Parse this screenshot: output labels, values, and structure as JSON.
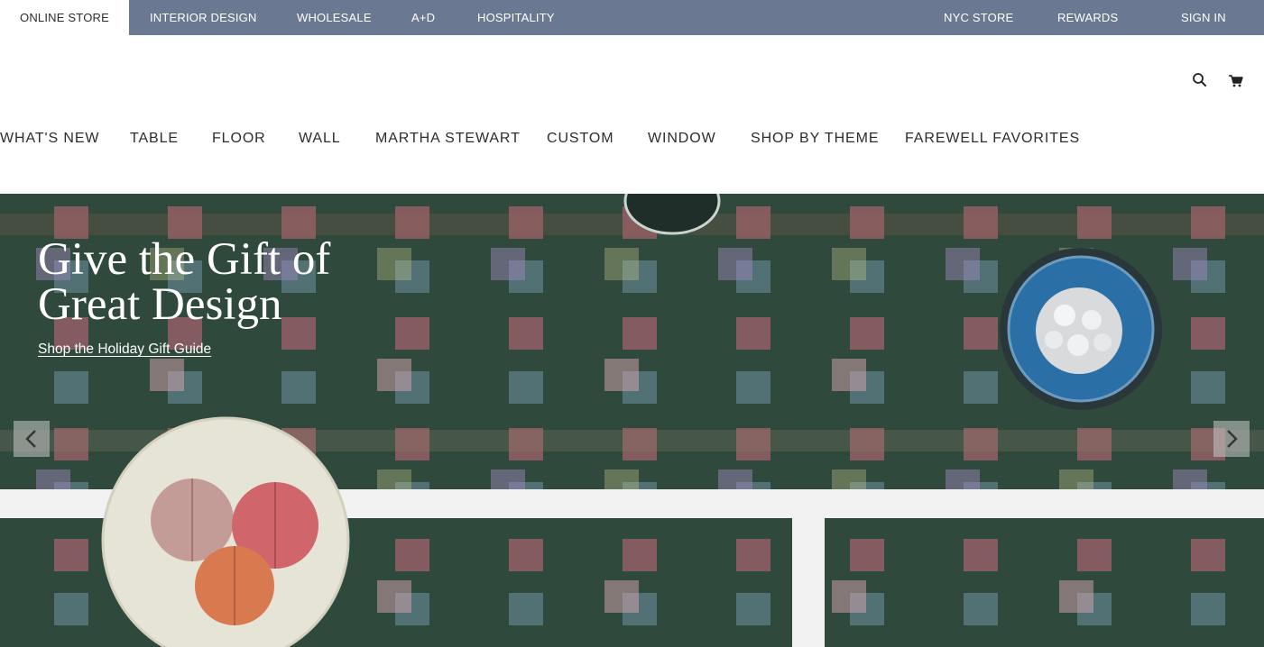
{
  "topbar": {
    "tabs": [
      "ONLINE STORE",
      "INTERIOR DESIGN",
      "WHOLESALE",
      "A+D",
      "HOSPITALITY"
    ],
    "right_links": [
      "NYC STORE",
      "REWARDS",
      "SIGN IN"
    ],
    "active_tab": "ONLINE STORE",
    "bar_color": "#6b7892"
  },
  "header": {
    "icons": [
      "search-icon",
      "cart-icon"
    ]
  },
  "nav": {
    "items": [
      "WHAT'S NEW",
      "TABLE",
      "FLOOR",
      "WALL",
      "MARTHA STEWART",
      "CUSTOM",
      "WINDOW",
      "SHOP BY THEME",
      "FAREWELL FAVORITES"
    ]
  },
  "hero": {
    "title_line1": "Give the Gift of",
    "title_line2": "Great Design",
    "link": "Shop the Holiday Gift Guide",
    "prev_icon": "chevron-left-icon",
    "next_icon": "chevron-right-icon",
    "background_color": "#2f4a3d"
  }
}
